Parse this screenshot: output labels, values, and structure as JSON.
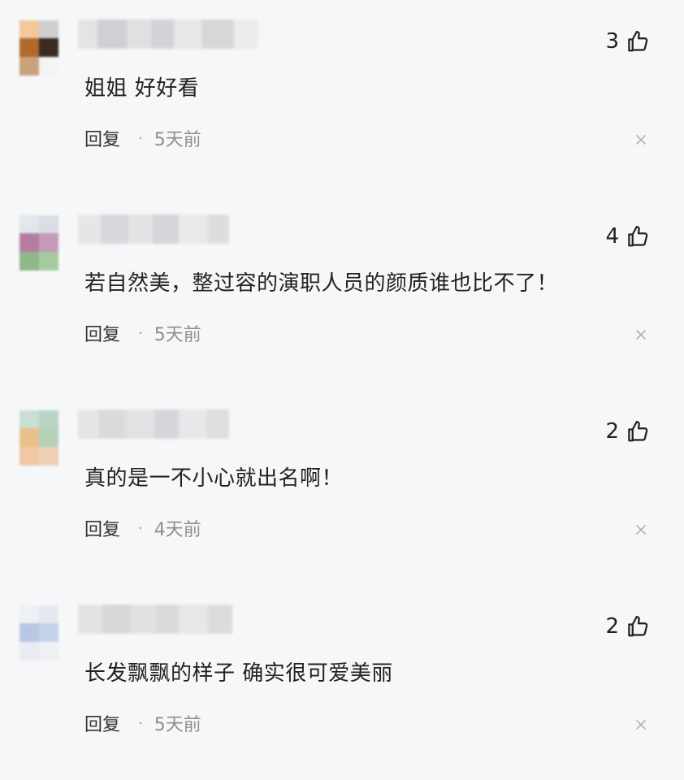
{
  "colors": {
    "background": "#f6f7f9",
    "text": "#222222",
    "meta_text": "#8e8e8e"
  },
  "comments": [
    {
      "text": "姐姐 好好看",
      "reply_label": "回复",
      "time": "5天前",
      "likes": "3",
      "avatar_colors": [
        "#f3c89a",
        "#cfcfcf",
        "#b06a2c",
        "#3a2a22",
        "#c9a27a",
        "#f4f4f4"
      ],
      "name_colors": [
        "#e4e4e6",
        "#cfd0d3",
        "#dfe0e2",
        "#d2d3d6",
        "#e8e8ea",
        "#d6d7d9",
        "#ececee"
      ]
    },
    {
      "text": "若自然美，整过容的演职人员的颜质谁也比不了！",
      "reply_label": "回复",
      "time": "5天前",
      "likes": "4",
      "avatar_colors": [
        "#e3e6ec",
        "#d9dde4",
        "#b47da0",
        "#c59ab7",
        "#8fb888",
        "#a6caa0"
      ],
      "name_colors": [
        "#e6e6e8",
        "#d7d8db",
        "#e2e3e5",
        "#d4d5d8",
        "#e9e9eb",
        "#dcdddf"
      ]
    },
    {
      "text": "真的是一不小心就出名啊！",
      "reply_label": "回复",
      "time": "4天前",
      "likes": "2",
      "avatar_colors": [
        "#c9dfd4",
        "#b9d3c7",
        "#e8c08a",
        "#b6d1b8",
        "#f2c7a4",
        "#eed0b7"
      ],
      "name_colors": [
        "#e5e5e7",
        "#d9dadc",
        "#e1e2e4",
        "#d5d6d9",
        "#e8e8ea",
        "#dedfe1"
      ]
    },
    {
      "text": "长发飘飘的样子 确实很可爱美丽",
      "reply_label": "回复",
      "time": "5天前",
      "likes": "2",
      "avatar_colors": [
        "#eef0f4",
        "#e5e8ee",
        "#b8c8e4",
        "#c4d2ea",
        "#e9ecf2",
        "#eef0f4"
      ],
      "name_colors": [
        "#e3e3e5",
        "#d6d7d9",
        "#e0e1e3",
        "#d9dadc",
        "#e7e7e9",
        "#dcdcde"
      ]
    }
  ]
}
